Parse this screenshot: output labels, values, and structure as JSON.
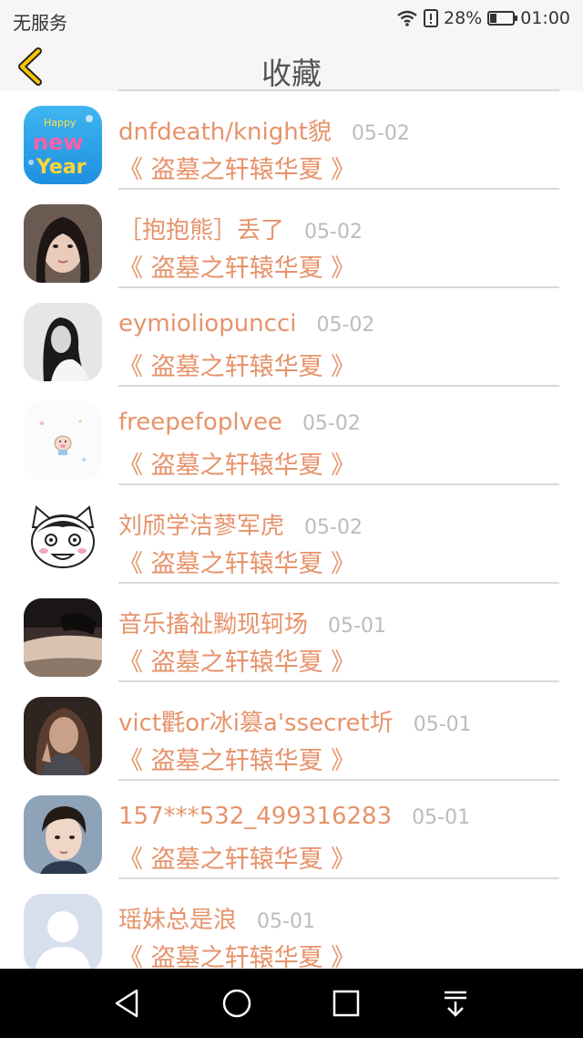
{
  "status_bar": {
    "carrier": "无服务",
    "battery_percent": "28%",
    "battery_level": 0.28,
    "time": "01:00",
    "icons": [
      "wifi-icon",
      "alert-icon",
      "battery-icon"
    ]
  },
  "header": {
    "title": "收藏",
    "back_icon": "chevron-left-icon",
    "accent_color": "#f6c600"
  },
  "colors": {
    "name": "#e6936b",
    "date": "#bcbcbc"
  },
  "favorites": [
    {
      "name": "dnfdeath/knight貌",
      "date": "05-02",
      "work": "《 盗墓之轩辕华夏 》",
      "avatar": "new-year-avatar"
    },
    {
      "name": "［抱抱熊］丢了",
      "date": "05-02",
      "work": "《 盗墓之轩辕华夏 》",
      "avatar": "girl-portrait-avatar"
    },
    {
      "name": "eymioliopuncci",
      "date": "05-02",
      "work": "《 盗墓之轩辕华夏 》",
      "avatar": "grayscale-girl-avatar"
    },
    {
      "name": "freepefoplvee",
      "date": "05-02",
      "work": "《 盗墓之轩辕华夏 》",
      "avatar": "cartoon-pig-avatar"
    },
    {
      "name": "刘颀学洁蓼军虎",
      "date": "05-02",
      "work": "《 盗墓之轩辕华夏 》",
      "avatar": "cartoon-cat-avatar"
    },
    {
      "name": "音乐搐祉黝现轲场",
      "date": "05-01",
      "work": "《 盗墓之轩辕华夏 》",
      "avatar": "couple-photo-avatar"
    },
    {
      "name": "vict氍or冰i篡a'ssecret圻",
      "date": "05-01",
      "work": "《 盗墓之轩辕华夏 》",
      "avatar": "person-photo-avatar"
    },
    {
      "name": "157***532_499316283",
      "date": "05-01",
      "work": "《 盗墓之轩辕华夏 》",
      "avatar": "young-man-avatar"
    },
    {
      "name": "瑶妹总是浪",
      "date": "05-01",
      "work": "《 盗墓之轩辕华夏 》",
      "avatar": "default-user-avatar"
    }
  ],
  "android_nav": {
    "buttons": [
      "back-triangle-icon",
      "home-circle-icon",
      "recents-square-icon",
      "notification-pulldown-icon"
    ]
  }
}
